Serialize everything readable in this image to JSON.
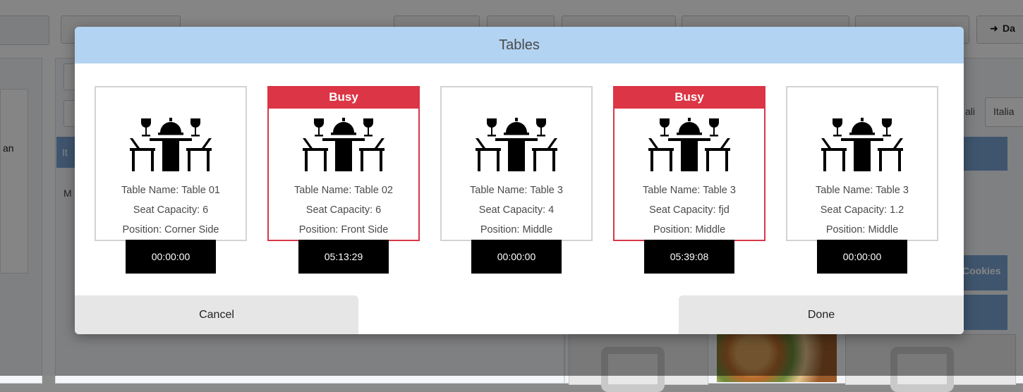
{
  "background": {
    "left_fragment_1": "an",
    "left_fragment_2": "It",
    "left_fragment_3": "M",
    "right_tab_1": "ali",
    "right_tab_2": "Italia",
    "right_card_label": "Cookies",
    "top_right_button": "Da",
    "top_right_icon": "sign-out-icon"
  },
  "modal": {
    "title": "Tables",
    "tables": [
      {
        "busy_label": "",
        "name": "Table Name: Table 01",
        "seats": "Seat Capacity: 6",
        "position": "Position: Corner Side",
        "timer": "00:00:00"
      },
      {
        "busy_label": "Busy",
        "name": "Table Name: Table 02",
        "seats": "Seat Capacity: 6",
        "position": "Position: Front Side",
        "timer": "05:13:29"
      },
      {
        "busy_label": "",
        "name": "Table Name: Table 3",
        "seats": "Seat Capacity: 4",
        "position": "Position: Middle",
        "timer": "00:00:00"
      },
      {
        "busy_label": "Busy",
        "name": "Table Name: Table 3",
        "seats": "Seat Capacity: fjd",
        "position": "Position: Middle",
        "timer": "05:39:08"
      },
      {
        "busy_label": "",
        "name": "Table Name: Table 3",
        "seats": "Seat Capacity: 1.2",
        "position": "Position: Middle",
        "timer": "00:00:00"
      }
    ],
    "cancel_label": "Cancel",
    "done_label": "Done"
  },
  "colors": {
    "header_bg": "#b3d3f2",
    "busy_red": "#dc3545",
    "timer_bg": "#000000",
    "footer_btn_bg": "#e6e6e6"
  },
  "icons": {
    "table": "dining-table-icon"
  }
}
